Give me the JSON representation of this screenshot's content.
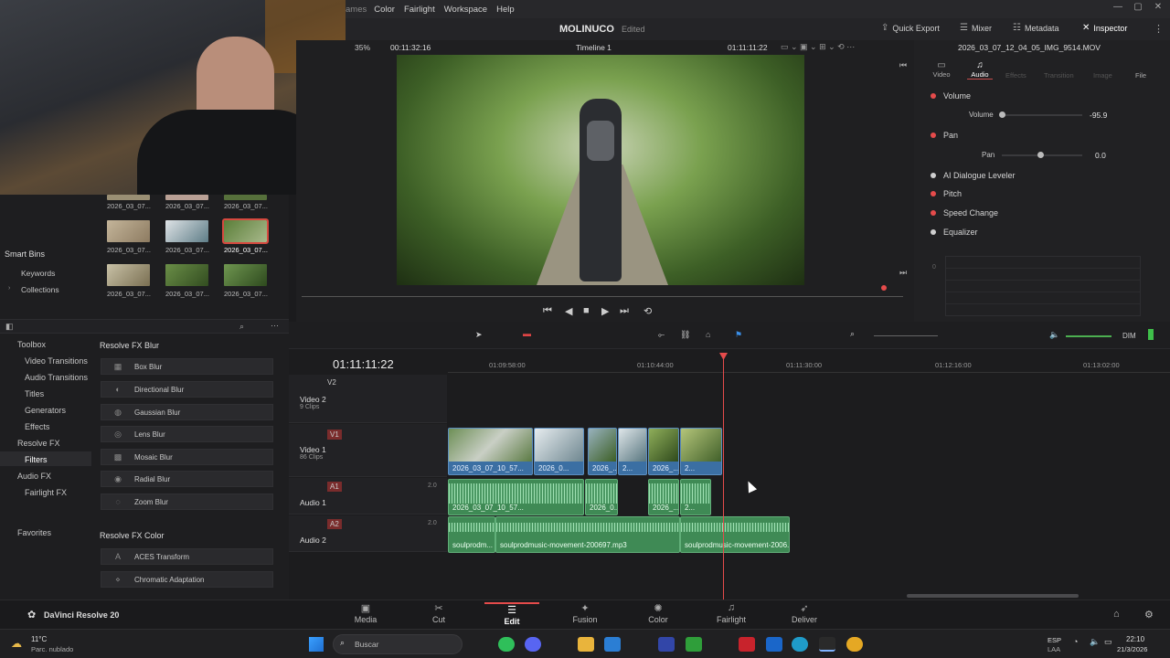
{
  "menu": {
    "items": [
      "Color",
      "Fairlight",
      "Workspace",
      "Help"
    ],
    "left_fragment": "ames"
  },
  "topbar": {
    "project_title": "MOLINUCO",
    "status": "Edited",
    "buttons": [
      "Quick Export",
      "Mixer",
      "Metadata",
      "Inspector"
    ]
  },
  "viewer": {
    "zoom": "35%",
    "timecode_left": "00:11:32:16",
    "timeline_name": "Timeline 1",
    "timecode_right": "01:11:11:22"
  },
  "inspector": {
    "filename": "2026_03_07_12_04_05_IMG_9514.MOV",
    "tabs": [
      "Video",
      "Audio",
      "Effects",
      "Transition",
      "Image",
      "File"
    ],
    "active_tab": "Audio",
    "sections": [
      {
        "label": "Volume",
        "dot": "red"
      },
      {
        "label": "Pan",
        "dot": "red"
      },
      {
        "label": "AI Dialogue Leveler",
        "dot": "white"
      },
      {
        "label": "Pitch",
        "dot": "red"
      },
      {
        "label": "Speed Change",
        "dot": "red"
      },
      {
        "label": "Equalizer",
        "dot": "white"
      }
    ],
    "volume_label": "Volume",
    "volume_value": "-95.9",
    "pan_label": "Pan",
    "pan_value": "0.0",
    "eq_ticks": [
      "0",
      "-",
      "-",
      "-",
      "-"
    ]
  },
  "media_pool": {
    "thumb_labels": [
      "2026_03_07...",
      "2026_03_07...",
      "2026_03_07...",
      "2026_03_07...",
      "2026_03_07...",
      "2026_03_07...",
      "2026_03_07...",
      "2026_03_07...",
      "2026_03_07..."
    ],
    "smart_bins": "Smart Bins",
    "keywords": "Keywords",
    "collections": "Collections"
  },
  "effects": {
    "tree": [
      "Toolbox",
      "Video Transitions",
      "Audio Transitions",
      "Titles",
      "Generators",
      "Effects",
      "Resolve FX",
      "Filters",
      "Audio FX",
      "Fairlight FX"
    ],
    "favorites": "Favorites",
    "group1": "Resolve FX Blur",
    "blur_items": [
      "Box Blur",
      "Directional Blur",
      "Gaussian Blur",
      "Lens Blur",
      "Mosaic Blur",
      "Radial Blur",
      "Zoom Blur"
    ],
    "group2": "Resolve FX Color",
    "color_items": [
      "ACES Transform",
      "Chromatic Adaptation"
    ]
  },
  "timeline": {
    "timecode": "01:11:11:22",
    "ruler": [
      "01:09:58:00",
      "01:10:44:00",
      "01:11:30:00",
      "01:12:16:00",
      "01:13:02:00"
    ],
    "tracks": [
      {
        "id": "V2",
        "name": "Video 2",
        "count": "9 Clips"
      },
      {
        "id": "V1",
        "name": "Video 1",
        "count": "86 Clips"
      },
      {
        "id": "A1",
        "name": "Audio 1",
        "level": "2.0"
      },
      {
        "id": "A2",
        "name": "Audio 2",
        "level": "2.0"
      }
    ],
    "video_clips": [
      "2026_03_07_10_57...",
      "2026_0...",
      "2026_...",
      "2...",
      "2026_...",
      "2..."
    ],
    "audio1_clips": [
      "2026_03_07_10_57...",
      "2026_0...",
      "2026_...",
      "2..."
    ],
    "audio2_clips": [
      "soulprodm...",
      "soulprodmusic-movement-200697.mp3",
      "soulprodmusic-movement-2006..."
    ],
    "dim": "DIM"
  },
  "pages": {
    "items": [
      "Media",
      "Cut",
      "Edit",
      "Fusion",
      "Color",
      "Fairlight",
      "Deliver"
    ],
    "active": "Edit"
  },
  "app": {
    "name": "DaVinci Resolve 20"
  },
  "taskbar": {
    "weather_temp": "11°C",
    "weather_desc": "Parc. nublado",
    "search": "Buscar",
    "lang": "ESP",
    "lang2": "LAA",
    "time": "22:10",
    "date": "21/3/2026"
  },
  "colors": {
    "accent_red": "#e54b4b",
    "video_clip": "#3b6fa3",
    "audio_clip": "#3f8a55"
  }
}
